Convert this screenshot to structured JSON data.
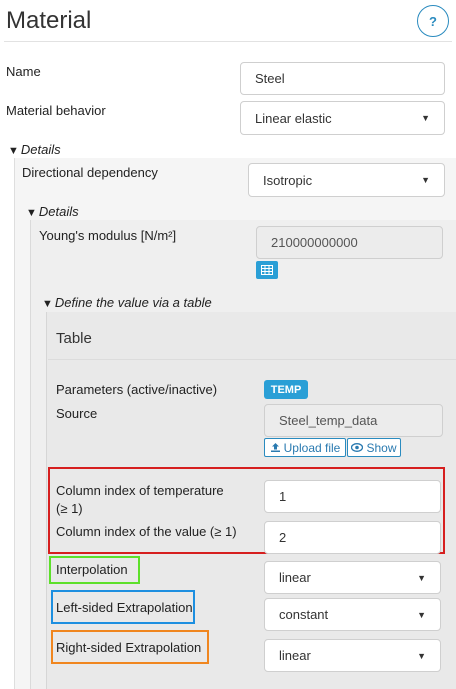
{
  "header": {
    "title": "Material",
    "help_label": "?"
  },
  "form": {
    "name_label": "Name",
    "name_value": "Steel",
    "behavior_label": "Material behavior",
    "behavior_value": "Linear elastic"
  },
  "details1": {
    "toggle_label": "Details",
    "directional_label": "Directional dependency",
    "directional_value": "Isotropic"
  },
  "details2": {
    "toggle_label": "Details",
    "youngs_label": "Young's modulus [N/m²]",
    "youngs_value": "210000000000"
  },
  "table_section": {
    "toggle_label": "Define the value via a table",
    "title": "Table",
    "params_label": "Parameters (active/inactive)",
    "param_badge": "TEMP",
    "source_label": "Source",
    "source_value": "Steel_temp_data",
    "upload_label": "Upload file",
    "show_label": "Show",
    "temp_col_label_line1": "Column index of temperature",
    "temp_col_label_line2": "(≥ 1)",
    "temp_col_value": "1",
    "value_col_label": "Column index of the value (≥ 1)",
    "value_col_value": "2",
    "interp_label": "Interpolation",
    "interp_value": "linear",
    "left_extrap_label": "Left-sided Extrapolation",
    "left_extrap_value": "constant",
    "right_extrap_label": "Right-sided Extrapolation",
    "right_extrap_value": "linear"
  },
  "colors": {
    "accent": "#2a9fd6",
    "highlight_red": "#d61f1f",
    "highlight_green": "#5de02a",
    "highlight_blue": "#1d8fe0",
    "highlight_orange": "#f0861f"
  }
}
